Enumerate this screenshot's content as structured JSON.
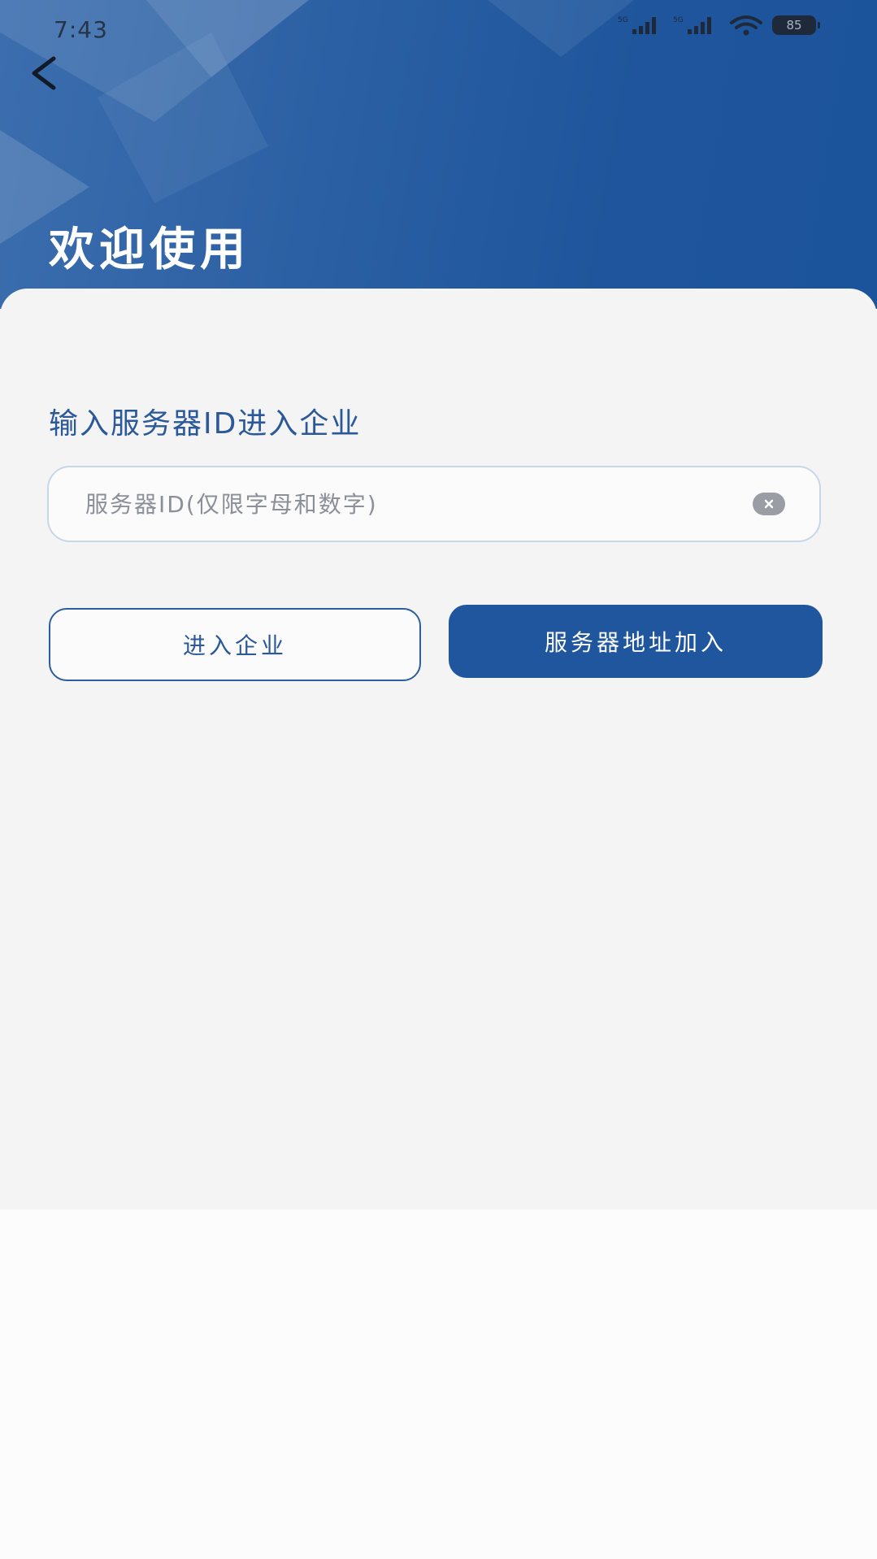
{
  "status_bar": {
    "time": "7:43",
    "signal1": "5G",
    "signal2": "5G",
    "battery": "85"
  },
  "header": {
    "title": "欢迎使用"
  },
  "form": {
    "section_label": "输入服务器ID进入企业",
    "server_id_placeholder": "服务器ID(仅限字母和数字)",
    "server_id_value": ""
  },
  "actions": {
    "enter_label": "进入企业",
    "server_address_label": "服务器地址加入"
  },
  "colors": {
    "brand": "#1f569d",
    "background": "#f4f4f5"
  }
}
